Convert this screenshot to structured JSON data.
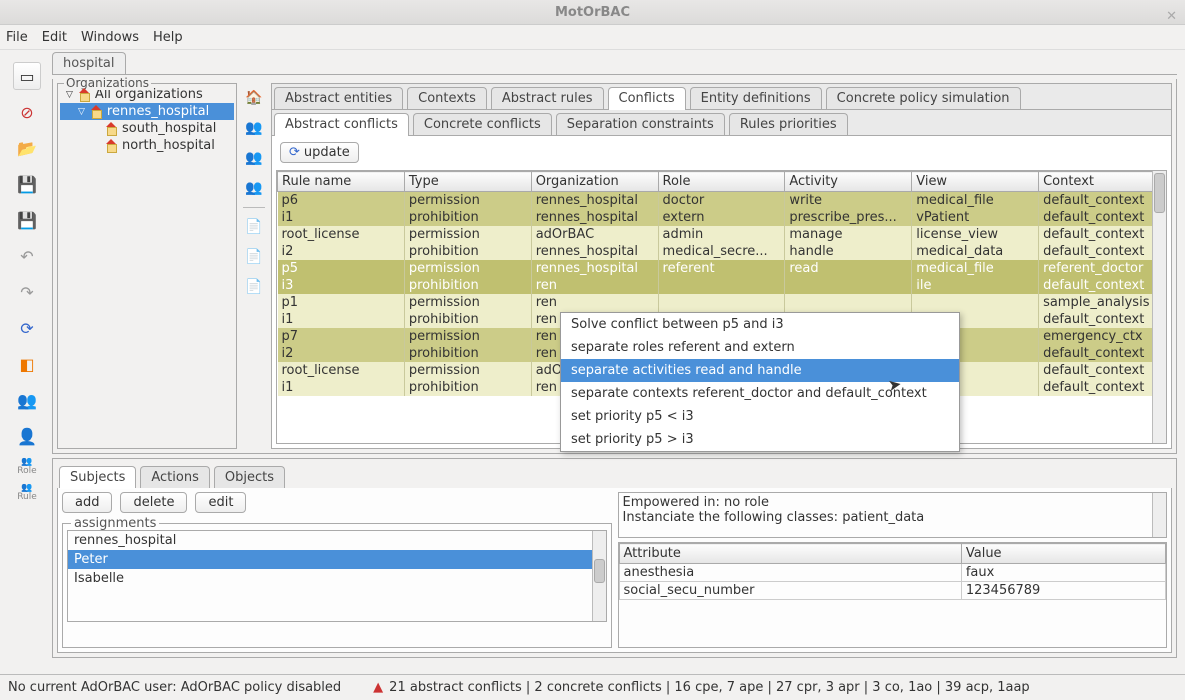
{
  "title": "MotOrBAC",
  "menubar": [
    "File",
    "Edit",
    "Windows",
    "Help"
  ],
  "policy_tab": "hospital",
  "org_tree": {
    "legend": "Organizations",
    "root": "All organizations",
    "sel": "rennes_hospital",
    "children": [
      "south_hospital",
      "north_hospital"
    ]
  },
  "top_tabs": [
    "Abstract entities",
    "Contexts",
    "Abstract rules",
    "Conflicts",
    "Entity definitions",
    "Concrete policy simulation"
  ],
  "top_active": 3,
  "sub_tabs": [
    "Abstract conflicts",
    "Concrete conflicts",
    "Separation constraints",
    "Rules priorities"
  ],
  "sub_active": 0,
  "update_label": "update",
  "conf_headers": [
    "Rule name",
    "Type",
    "Organization",
    "Role",
    "Activity",
    "View",
    "Context"
  ],
  "conf_rows": [
    {
      "c": [
        "p6",
        "permission",
        "rennes_hospital",
        "doctor",
        "write",
        "medical_file",
        "default_context"
      ],
      "cls": "r-dark"
    },
    {
      "c": [
        "i1",
        "prohibition",
        "rennes_hospital",
        "extern",
        "prescribe_pres...",
        "vPatient",
        "default_context"
      ],
      "cls": "r-dark"
    },
    {
      "c": [
        "root_license",
        "permission",
        "adOrBAC",
        "admin",
        "manage",
        "license_view",
        "default_context"
      ],
      "cls": "r-light"
    },
    {
      "c": [
        "i2",
        "prohibition",
        "rennes_hospital",
        "medical_secre...",
        "handle",
        "medical_data",
        "default_context"
      ],
      "cls": "r-light"
    },
    {
      "c": [
        "p5",
        "permission",
        "rennes_hospital",
        "referent",
        "read",
        "medical_file",
        "referent_doctor"
      ],
      "cls": "r-sel"
    },
    {
      "c": [
        "i3",
        "prohibition",
        "ren",
        "",
        "",
        "ile",
        "default_context"
      ],
      "cls": "r-sel"
    },
    {
      "c": [
        "p1",
        "permission",
        "ren",
        "",
        "",
        "",
        "sample_analysis"
      ],
      "cls": "r-light"
    },
    {
      "c": [
        "i1",
        "prohibition",
        "ren",
        "",
        "",
        "",
        "default_context"
      ],
      "cls": "r-light"
    },
    {
      "c": [
        "p7",
        "permission",
        "ren",
        "",
        "",
        "ata",
        "emergency_ctx"
      ],
      "cls": "r-dark"
    },
    {
      "c": [
        "i2",
        "prohibition",
        "ren",
        "",
        "",
        "ata",
        "default_context"
      ],
      "cls": "r-dark"
    },
    {
      "c": [
        "root_license",
        "permission",
        "adO",
        "",
        "",
        "ew",
        "default_context"
      ],
      "cls": "r-light"
    },
    {
      "c": [
        "i1",
        "prohibition",
        "ren",
        "",
        "",
        "",
        "default_context"
      ],
      "cls": "r-light"
    }
  ],
  "context_menu": {
    "items": [
      "Solve conflict between p5 and i3",
      "separate roles referent and extern",
      "separate activities read and handle",
      "separate contexts referent_doctor and default_context",
      "set priority p5 < i3",
      "set priority p5 > i3"
    ],
    "selected": 2
  },
  "lower_tabs": [
    "Subjects",
    "Actions",
    "Objects"
  ],
  "lower_active": 0,
  "buttons": {
    "add": "add",
    "delete": "delete",
    "edit": "edit"
  },
  "assignments": {
    "legend": "assignments",
    "items": [
      "rennes_hospital",
      "Peter",
      "Isabelle"
    ],
    "selected": 1
  },
  "info_lines": [
    "Empowered in:  no role",
    "Instanciate the following classes: patient_data"
  ],
  "attr_headers": [
    "Attribute",
    "Value"
  ],
  "attr_rows": [
    [
      "anesthesia",
      "faux"
    ],
    [
      "social_secu_number",
      "123456789"
    ]
  ],
  "status": {
    "left": "No current AdOrBAC user: AdOrBAC policy disabled",
    "right": "21 abstract conflicts | 2 concrete conflicts | 16 cpe, 7 ape | 27 cpr, 3 apr | 3 co, 1ao | 39 acp, 1aap"
  }
}
